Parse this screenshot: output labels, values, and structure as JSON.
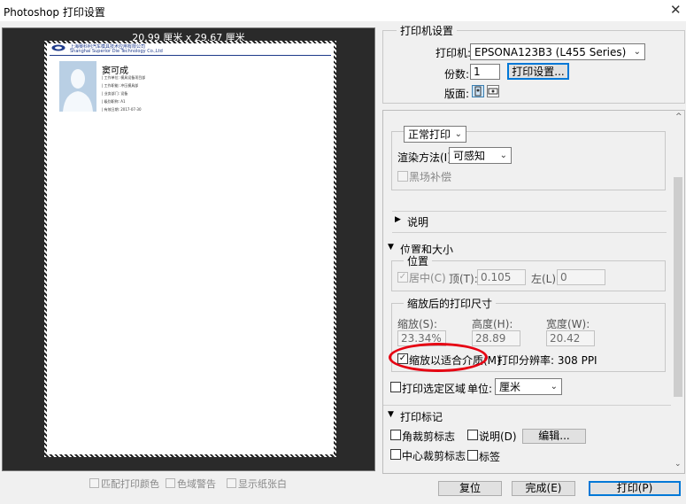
{
  "window": {
    "title": "Photoshop 打印设置",
    "close_glyph": "✕"
  },
  "preview": {
    "dimensions": "20.99 厘米 x 29.67 厘米",
    "doc": {
      "company_cn": "上海赛科利汽车模具技术应用有限公司",
      "company_en": "Shanghai Superior Die Technology Co.,Ltd",
      "person_name": "窦可成",
      "rows": [
        "| 工作单位: 模具设备项目部",
        "| 工作职能: 冲压模具部",
        "| 业务部门: 设备",
        "| 级别职称: A1",
        "| 有效日期: 2017-07-30"
      ]
    }
  },
  "bottom_checks": {
    "match_colors": "匹配打印颜色",
    "gamut_warning": "色域警告",
    "show_paper_white": "显示纸张白"
  },
  "printer_setup": {
    "title": "打印机设置",
    "printer_label": "打印机:",
    "printer_value": "EPSONA123B3 (L455 Series)",
    "copies_label": "份数:",
    "copies_value": "1",
    "print_settings_button": "打印设置...",
    "layout_label": "版面:"
  },
  "color_management": {
    "mode_value": "正常打印",
    "rendering_label": "渲染方法(I):",
    "rendering_value": "可感知",
    "black_point": "黑场补偿"
  },
  "description": {
    "label": "说明"
  },
  "position_size": {
    "title": "位置和大小",
    "position_title": "位置",
    "center_label": "居中(C)",
    "top_label": "顶(T):",
    "top_value": "0.105",
    "left_label": "左(L):",
    "left_value": "0",
    "scaled_title": "缩放后的打印尺寸",
    "scale_label": "缩放(S):",
    "scale_value": "23.34%",
    "height_label": "高度(H):",
    "height_value": "28.89",
    "width_label": "宽度(W):",
    "width_value": "20.42",
    "fit_media_label": "缩放以适合介质(M)",
    "resolution_text": "打印分辨率: 308 PPI",
    "print_selected_label": "打印选定区域",
    "unit_label": "单位:",
    "unit_value": "厘米"
  },
  "print_marks": {
    "title": "打印标记",
    "corner_crop": "角裁剪标志",
    "description_check": "说明(D)",
    "edit_button": "编辑...",
    "center_crop": "中心裁剪标志",
    "labels_check": "标签"
  },
  "footer": {
    "cancel_button": "复位",
    "done_button": "完成(E)",
    "print_button": "打印(P)"
  },
  "glyphs": {
    "chevron_down": "⌄",
    "triangle_right": "▶",
    "triangle_down": "▼",
    "scroll_up": "^",
    "scroll_down": "⌄",
    "check": "✓"
  },
  "colors": {
    "accent": "#0078d7",
    "highlight": "#e60012",
    "preview_bg": "#2a2a2a"
  }
}
